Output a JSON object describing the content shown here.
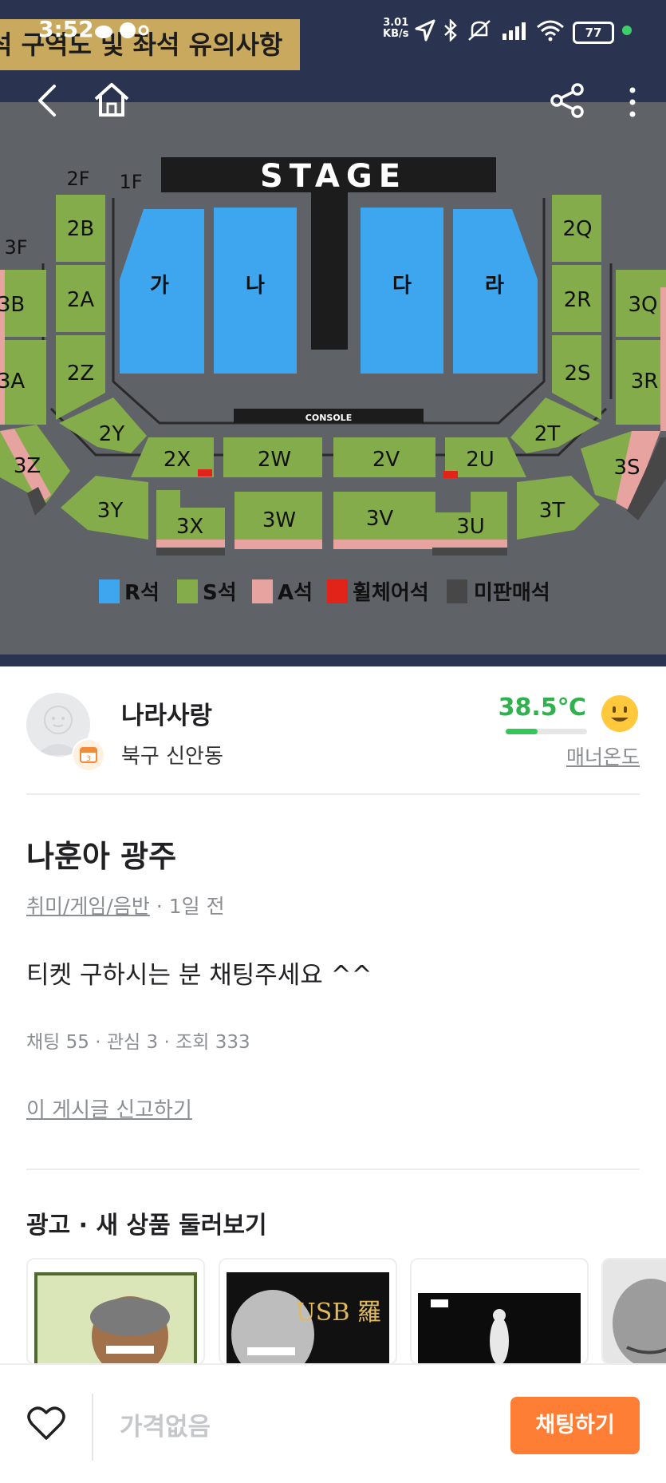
{
  "status_bar": {
    "time": "3:52",
    "speed_value": "3.01",
    "speed_unit": "KB/s",
    "battery": "77"
  },
  "hero": {
    "banner_text": "석 구역도 및 좌석 유의사항",
    "stage_label": "STAGE",
    "console_label": "CONSOLE",
    "floor_labels": [
      "2F",
      "1F",
      "3F"
    ],
    "r_sections": [
      "가",
      "나",
      "다",
      "라"
    ],
    "s_sections_left": [
      "2B",
      "2A",
      "2Z",
      "3B",
      "3A"
    ],
    "s_sections_right": [
      "2Q",
      "2R",
      "2S",
      "3Q",
      "3R"
    ],
    "lower_ring": [
      "2Y",
      "2X",
      "2W",
      "2V",
      "2U",
      "2T"
    ],
    "outer_ring": [
      "3Z",
      "3Y",
      "3X",
      "3W",
      "3V",
      "3U",
      "3T",
      "3S"
    ],
    "legend": [
      {
        "label": "R석",
        "color": "#3ea6ee"
      },
      {
        "label": "S석",
        "color": "#84ac4a"
      },
      {
        "label": "A석",
        "color": "#e7a3a0"
      },
      {
        "label": "휠체어석",
        "color": "#e2231a"
      },
      {
        "label": "미판매석",
        "color": "#474747"
      }
    ]
  },
  "seller": {
    "name": "나라사랑",
    "region": "북구 신안동",
    "temperature": "38.5℃",
    "temperature_level": 0.385,
    "manner_label": "매너온도"
  },
  "post": {
    "title": "나훈아 광주",
    "category": "취미/게임/음반",
    "separator": "·",
    "time_ago": "1일 전",
    "body": "티켓 구하시는 분 채팅주세요 ^^",
    "chat_label": "채팅",
    "chat_count": "55",
    "interest_label": "관심",
    "interest_count": "3",
    "view_label": "조회",
    "view_count": "333",
    "report_link": "이 게시글 신고하기"
  },
  "ads": {
    "title": "광고 · 새 상품 둘러보기",
    "card2_text": "USB 羅 勳"
  },
  "bottom_bar": {
    "price": "가격없음",
    "chat_button": "채팅하기"
  },
  "colors": {
    "accent": "#ff7e36",
    "temperature_green": "#2fb24e"
  }
}
